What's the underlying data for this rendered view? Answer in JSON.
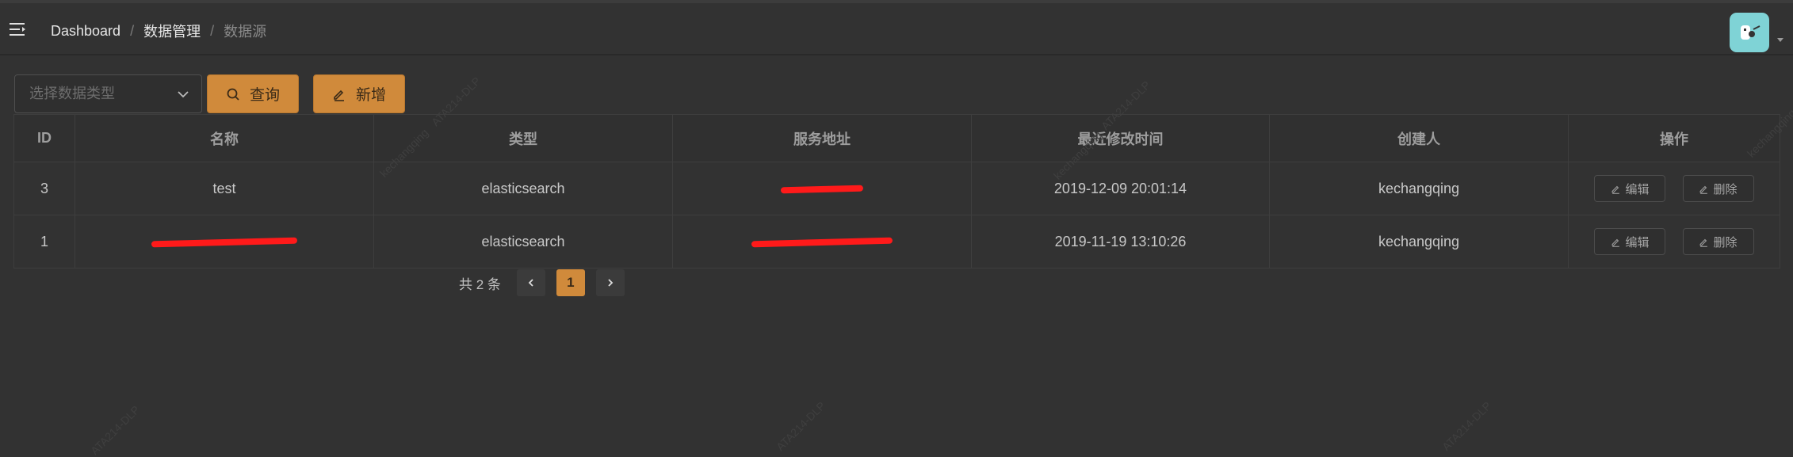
{
  "header": {
    "breadcrumb": [
      "Dashboard",
      "数据管理",
      "数据源"
    ],
    "breadcrumb_sep": "/"
  },
  "filter": {
    "type_placeholder": "选择数据类型",
    "query_label": "查询",
    "add_label": "新增"
  },
  "table": {
    "columns": [
      "ID",
      "名称",
      "类型",
      "服务地址",
      "最近修改时间",
      "创建人",
      "操作"
    ],
    "rows": [
      {
        "id": "3",
        "name": "test",
        "type": "elasticsearch",
        "address": "[redacted]",
        "modified": "2019-12-09 20:01:14",
        "creator": "kechangqing"
      },
      {
        "id": "1",
        "name": "[redacted]",
        "type": "elasticsearch",
        "address": "[redacted]",
        "modified": "2019-11-19 13:10:26",
        "creator": "kechangqing"
      }
    ],
    "edit_label": "编辑",
    "delete_label": "删除"
  },
  "pagination": {
    "total_text": "共 2 条",
    "current_page": "1"
  },
  "watermark": {
    "texts": [
      "ATA214-DLP",
      "kechangqing"
    ]
  },
  "colors": {
    "accent": "#d08a3b",
    "background": "#323232",
    "redaction": "#ff1a1a",
    "avatar": "#7fd3d6"
  }
}
